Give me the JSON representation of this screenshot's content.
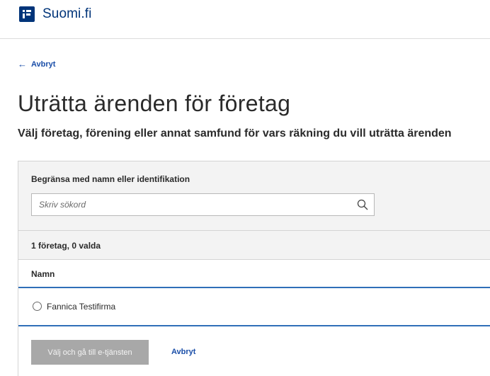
{
  "header": {
    "brand": "Suomi.fi"
  },
  "back_link": {
    "label": "Avbryt"
  },
  "page_title": "Uträtta ärenden för företag",
  "subtitle": "Välj företag, förening eller annat samfund för vars räkning du vill uträtta ärenden",
  "filter": {
    "label": "Begränsa med namn eller identifikation",
    "placeholder": "Skriv sökord",
    "value": ""
  },
  "results": {
    "count_text": "1 företag, 0 valda",
    "column_header": "Namn",
    "rows": [
      {
        "name": "Fannica Testifirma",
        "selected": false
      }
    ]
  },
  "actions": {
    "primary_label": "Välj och gå till e-tjänsten",
    "cancel_label": "Avbryt"
  },
  "colors": {
    "brand": "#003479",
    "link": "#1a4ea8",
    "divider": "#2f6fb8",
    "disabled_button": "#a8a8a8"
  }
}
